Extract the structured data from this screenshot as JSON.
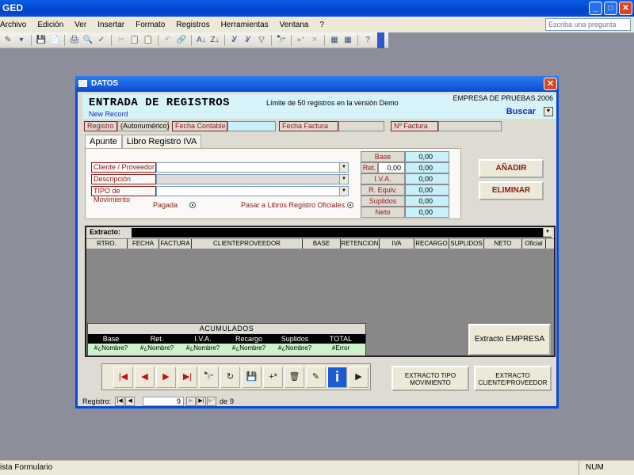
{
  "app": {
    "title": "GED",
    "win_buttons": [
      "_",
      "□",
      "✕"
    ]
  },
  "menu": {
    "items": [
      "Archivo",
      "Edición",
      "Ver",
      "Insertar",
      "Formato",
      "Registros",
      "Herramientas",
      "Ventana",
      "?"
    ],
    "help_placeholder": "Escriba una pregunta"
  },
  "toolbar": {
    "groups": [
      [
        "✎",
        "▾"
      ],
      [
        "💾",
        "📄"
      ],
      [
        "🖨",
        "🔍",
        "✓"
      ],
      [
        "✂",
        "📋",
        "📋"
      ],
      [
        "↶",
        "🔗"
      ],
      [
        "A↓",
        "Z↓"
      ],
      [
        "Ꮍ",
        "Ꮍ",
        "▽"
      ],
      [
        "🔭"
      ],
      [
        "▸*",
        "✕"
      ],
      [
        "▦",
        "▦"
      ],
      [
        "?"
      ]
    ]
  },
  "dialog": {
    "title": "DATOS",
    "close": "✕",
    "form_title": "ENTRADA DE REGISTROS",
    "limit_note": "Límite de 50 registros en la versión Demo",
    "new_record": "New Record",
    "company": "EMPRESA DE PRUEBAS 2006",
    "buscar": "Buscar",
    "info": {
      "registro_label": "Registro",
      "registro_value": "(Autonumérico)",
      "fecha_contable_label": "Fecha Contable",
      "fecha_factura_label": "Fecha Factura",
      "n_factura_label": "Nº Factura"
    },
    "tabs": [
      "Apunte",
      "Libro Registro IVA"
    ],
    "fields": {
      "cliente_label": "Cliente / Proveedor",
      "descripcion_label": "Descripción",
      "tipo_label": "TIPO de Movimiento",
      "pagada_label": "Pagada",
      "pasar_label": "Pasar a Libros Registro Oficiales"
    },
    "totals": {
      "base_label": "Base",
      "base_value": "0,00",
      "ret_label": "Ret.",
      "ret_pct": "0,00",
      "ret_value": "0,00",
      "iva_label": "I.V.A.",
      "iva_value": "0,00",
      "requiv_label": "R. Equiv.",
      "requiv_value": "0,00",
      "suplidos_label": "Suplidos",
      "suplidos_value": "0,00",
      "neto_label": "Neto",
      "neto_value": "0,00"
    },
    "buttons": {
      "anadir": "AÑADIR",
      "eliminar": "ELIMINAR",
      "extracto_empresa": "Extracto EMPRESA",
      "extracto_tipo": "EXTRACTO TIPO MOVIMIENTO",
      "extracto_cliente": "EXTRACTO CLIENTE/PROVEEDOR"
    },
    "extracto": {
      "label": "Extracto:",
      "columns": [
        "RTRO.",
        "FECHA",
        "FACTURA",
        "CLIENTEPROVEEDOR",
        "BASE",
        "RETENCION",
        "IVA",
        "RECARGO",
        "SUPLIDOS",
        "NETO",
        "Oficial"
      ]
    },
    "acumulados": {
      "title": "ACUMULADOS",
      "headers": [
        "Base",
        "Ret.",
        "I.V.A.",
        "Recargo",
        "Suplidos",
        "TOTAL"
      ],
      "values": [
        "#¿Nombre?",
        "#¿Nombre?",
        "#¿Nombre?",
        "#¿Nombre?",
        "#¿Nombre?",
        "#Error"
      ]
    },
    "nav_icons": [
      "|◀",
      "◀",
      "▶",
      "▶|",
      "🔭",
      "↻",
      "💾",
      "+*",
      "🗑",
      "✎",
      "i",
      "▶"
    ],
    "record_bar": {
      "label": "Registro:",
      "current": "9",
      "of": "de",
      "total": "9",
      "buttons": [
        "|◀",
        "◀",
        "▶",
        "▶|",
        "▶*"
      ]
    }
  },
  "status": {
    "text": "ista Formulario",
    "num": "NUM"
  }
}
